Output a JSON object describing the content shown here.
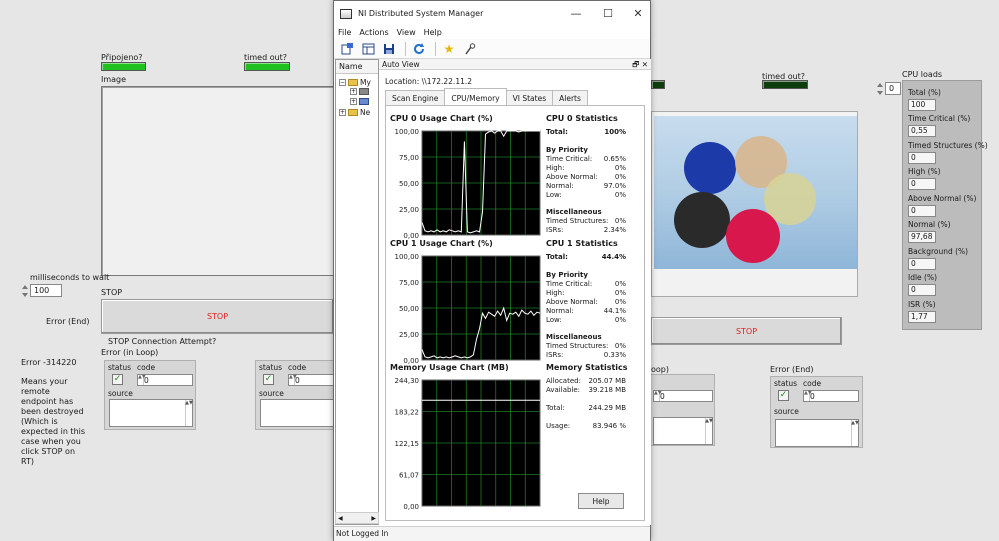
{
  "front_panel": {
    "pripojeno_label": "Připojeno?",
    "timed_out_label": "timed out?",
    "timed_out_label_right": "timed out?",
    "image_label": "Image",
    "ms_wait_label": "milliseconds to wait",
    "ms_wait_value": "100",
    "stop_label": "STOP",
    "stop_button_label": "STOP",
    "stop_button_right_label": "STOP",
    "error_end_label": "Error (End)",
    "stop_conn_label": "STOP Connection Attempt?",
    "error_in_loop_label": "Error (in Loop)",
    "error_in_loop_right_label": "oop)",
    "error_end_right_label": "Error (End)",
    "error_code": "Error -314220",
    "error_message": "Means your remote endpoint has been destroyed (Which is expected in this case when you click STOP on RT)",
    "cluster_status": "status",
    "cluster_code": "code",
    "cluster_code_value": "0",
    "cluster_source": "source",
    "cpu_index_value": "0",
    "cpu_loads_label": "CPU loads",
    "cpu_loads": [
      {
        "label": "Total (%)",
        "value": "100"
      },
      {
        "label": "Time Critical (%)",
        "value": "0,55"
      },
      {
        "label": "Timed Structures (%)",
        "value": "0"
      },
      {
        "label": "High (%)",
        "value": "0"
      },
      {
        "label": "Above Normal (%)",
        "value": "0"
      },
      {
        "label": "Normal (%)",
        "value": "97,68"
      },
      {
        "label": "Background (%)",
        "value": "0"
      },
      {
        "label": "Idle (%)",
        "value": "0"
      },
      {
        "label": "ISR (%)",
        "value": "1,77"
      }
    ],
    "colors": {
      "led_on": "#20c020",
      "led_off": "#0d3d0d",
      "stop_text": "#e02020"
    }
  },
  "window": {
    "title": "NI Distributed System Manager",
    "menu": [
      "File",
      "Actions",
      "View",
      "Help"
    ],
    "toolbar_icons": [
      "new-icon",
      "grid-icon",
      "save-icon",
      "refresh-icon",
      "star-icon",
      "probe-icon"
    ],
    "tree_header": "Name",
    "tree_nodes": [
      "My",
      "Ne"
    ],
    "auto_view_title": "Auto View",
    "location_label": "Location:",
    "location_value": "\\\\172.22.11.2",
    "tabs": [
      "Scan Engine",
      "CPU/Memory",
      "VI States",
      "Alerts"
    ],
    "active_tab": "CPU/Memory",
    "help_button": "Help",
    "status_bar": "Not Logged In"
  },
  "stats": {
    "cpu0": {
      "title": "CPU 0 Statistics",
      "total_label": "Total:",
      "total": "100%",
      "priority_header": "By Priority",
      "priority": [
        {
          "label": "Time Critical:",
          "value": "0.65%"
        },
        {
          "label": "High:",
          "value": "0%"
        },
        {
          "label": "Above Normal:",
          "value": "0%"
        },
        {
          "label": "Normal:",
          "value": "97.0%"
        },
        {
          "label": "Low:",
          "value": "0%"
        }
      ],
      "misc_header": "Miscellaneous",
      "misc": [
        {
          "label": "Timed Structures:",
          "value": "0%"
        },
        {
          "label": "ISRs:",
          "value": "2.34%"
        }
      ]
    },
    "cpu1": {
      "title": "CPU 1 Statistics",
      "total_label": "Total:",
      "total": "44.4%",
      "priority_header": "By Priority",
      "priority": [
        {
          "label": "Time Critical:",
          "value": "0%"
        },
        {
          "label": "High:",
          "value": "0%"
        },
        {
          "label": "Above Normal:",
          "value": "0%"
        },
        {
          "label": "Normal:",
          "value": "44.1%"
        },
        {
          "label": "Low:",
          "value": "0%"
        }
      ],
      "misc_header": "Miscellaneous",
      "misc": [
        {
          "label": "Timed Structures:",
          "value": "0%"
        },
        {
          "label": "ISRs:",
          "value": "0.33%"
        }
      ]
    },
    "memory": {
      "title": "Memory Statistics",
      "rows": [
        {
          "label": "Allocated:",
          "value": "205.07 MB"
        },
        {
          "label": "Available:",
          "value": "39.218 MB"
        },
        {
          "label": "Total:",
          "value": "244.29 MB"
        },
        {
          "label": "Usage:",
          "value": "83.946 %"
        }
      ]
    }
  },
  "chart_data": [
    {
      "type": "line",
      "title": "CPU 0 Usage Chart (%)",
      "ylim": [
        0,
        100
      ],
      "yticks": [
        "100,00",
        "75,00",
        "50,00",
        "25,00",
        "0,00"
      ],
      "grid": true,
      "colors": {
        "background": "#000000",
        "grid": "#1f7a2a",
        "line": "#ffffff"
      },
      "values": [
        12,
        4,
        3,
        4,
        3,
        5,
        3,
        4,
        3,
        5,
        4,
        3,
        4,
        3,
        90,
        3,
        2,
        3,
        4,
        3,
        22,
        97,
        99,
        100,
        98,
        100,
        100,
        95,
        100,
        100,
        100,
        100,
        99,
        100,
        100,
        100,
        100,
        100,
        100,
        100
      ]
    },
    {
      "type": "line",
      "title": "CPU 1 Usage Chart (%)",
      "ylim": [
        0,
        100
      ],
      "yticks": [
        "100,00",
        "75,00",
        "50,00",
        "25,00",
        "0,00"
      ],
      "grid": true,
      "colors": {
        "background": "#000000",
        "grid": "#1f7a2a",
        "line": "#ffffff"
      },
      "values": [
        10,
        3,
        2,
        3,
        4,
        2,
        3,
        2,
        3,
        2,
        3,
        4,
        3,
        2,
        3,
        2,
        3,
        5,
        20,
        30,
        45,
        40,
        46,
        44,
        42,
        47,
        43,
        50,
        38,
        45,
        44,
        46,
        42,
        48,
        45,
        44,
        47,
        43,
        46,
        45
      ]
    },
    {
      "type": "line",
      "title": "Memory Usage Chart (MB)",
      "ylim": [
        0,
        244.3
      ],
      "yticks": [
        "244,30",
        "183,22",
        "122,15",
        "61,07",
        "0,00"
      ],
      "grid": true,
      "colors": {
        "background": "#000000",
        "grid": "#1f7a2a",
        "line": "#ffffff"
      },
      "values": [
        205,
        205,
        205,
        205,
        205,
        205,
        205,
        205,
        205,
        205,
        205,
        205,
        205,
        205,
        205,
        205,
        205,
        205,
        205,
        205,
        205,
        205,
        205,
        205,
        205,
        205,
        205,
        205,
        205,
        205,
        205,
        205,
        205,
        205,
        205,
        205,
        205,
        205,
        205,
        205
      ]
    }
  ]
}
